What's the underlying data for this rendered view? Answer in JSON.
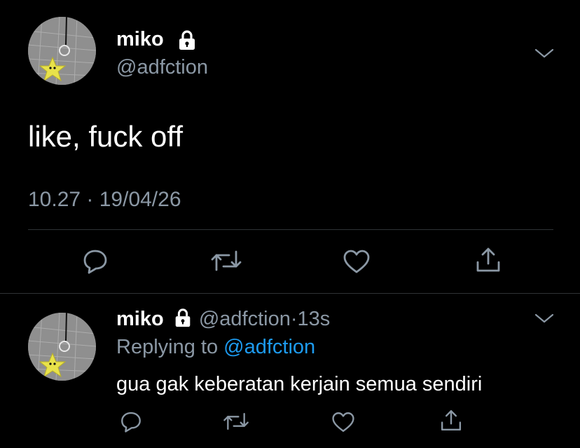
{
  "main_tweet": {
    "author_name": "miko",
    "author_handle": "@adfction",
    "avatar_icon": "avatar-star-keychain",
    "locked_icon": "lock-icon",
    "text": "like, fuck off",
    "timestamp": "10.27 · 19/04/26",
    "actions": [
      "reply-icon",
      "retweet-icon",
      "like-icon",
      "share-icon"
    ]
  },
  "reply_tweet": {
    "author_name": "miko",
    "author_handle": "@adfction",
    "separator": "·",
    "time_ago": "13s",
    "replying_label": "Replying to",
    "replying_to": "@adfction",
    "text": "gua gak keberatan kerjain semua sendiri",
    "actions": [
      "reply-icon",
      "retweet-icon",
      "like-icon",
      "share-icon"
    ]
  },
  "colors": {
    "background": "#000000",
    "text": "#ffffff",
    "muted": "#8b98a5",
    "link": "#1d9bf0",
    "divider": "#2f3336"
  }
}
